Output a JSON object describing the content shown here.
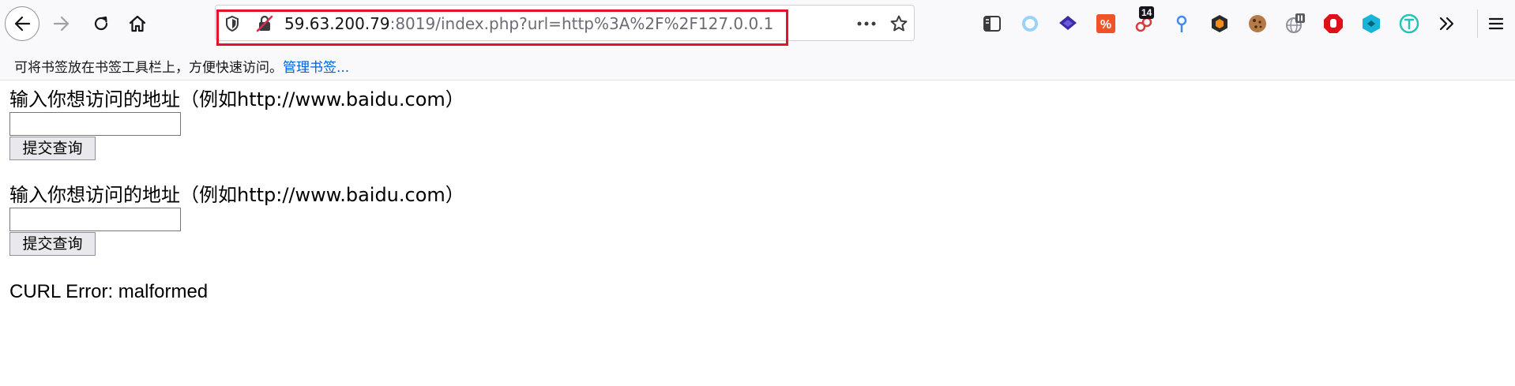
{
  "browser": {
    "url_host": "59.63.200.79",
    "url_rest": ":8019/index.php?url=http%3A%2F%2F127.0.0.1",
    "extension_badge": "14"
  },
  "bookmarks_bar": {
    "hint_text": "可将书签放在书签工具栏上，方便快速访问。",
    "manage_link": "管理书签..."
  },
  "page": {
    "forms": [
      {
        "label": "输入你想访问的地址（例如http://www.baidu.com）",
        "input_value": "",
        "submit_label": "提交查询"
      },
      {
        "label": "输入你想访问的地址（例如http://www.baidu.com）",
        "input_value": "",
        "submit_label": "提交查询"
      }
    ],
    "error_text": "CURL Error: malformed"
  },
  "colors": {
    "highlight_border": "#e8102a",
    "link": "#0061e0"
  }
}
